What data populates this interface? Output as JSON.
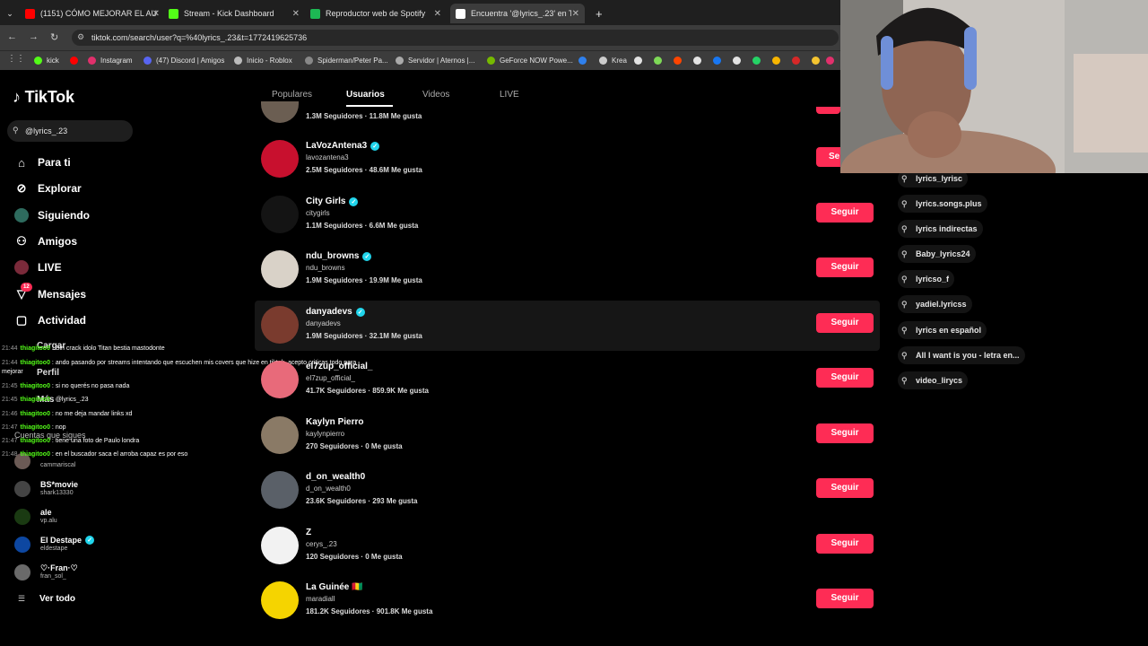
{
  "browser": {
    "tabs": [
      {
        "title": "(1151) CÓMO MEJORAR EL AU",
        "color": "#ff0000"
      },
      {
        "title": "Stream - Kick Dashboard",
        "color": "#53fc18"
      },
      {
        "title": "Reproductor web de Spotify: m",
        "color": "#1db954"
      },
      {
        "title": "Encuentra '@lyrics_.23' en TikTo",
        "color": "#ffffff"
      }
    ],
    "new_tab": "+",
    "url": "tiktok.com/search/user?q=%40lyrics_.23&t=1772419625736",
    "bookmarks": [
      {
        "label": "kick",
        "color": "#53fc18"
      },
      {
        "label": "",
        "color": "#ff0000"
      },
      {
        "label": "Instagram",
        "color": "#e1306c"
      },
      {
        "label": "(47) Discord | Amigos",
        "color": "#5865f2"
      },
      {
        "label": "Inicio - Roblox",
        "color": "#bbbbbb"
      },
      {
        "label": "Spiderman/Peter Pa...",
        "color": "#888888"
      },
      {
        "label": "Servidor | Aternos |...",
        "color": "#aaaaaa"
      },
      {
        "label": "GeForce NOW Powe...",
        "color": "#76b900"
      },
      {
        "label": "",
        "color": "#2f80ed"
      },
      {
        "label": "Krea",
        "color": "#cccccc"
      }
    ]
  },
  "tiktok": {
    "logo": "TikTok",
    "search_value": "@lyrics_.23",
    "nav": [
      {
        "label": "Para ti",
        "icon": "home-icon"
      },
      {
        "label": "Explorar",
        "icon": "compass-icon"
      },
      {
        "label": "Siguiendo",
        "icon": "following-icon"
      },
      {
        "label": "Amigos",
        "icon": "friends-icon"
      },
      {
        "label": "LIVE",
        "icon": "live-icon"
      },
      {
        "label": "Mensajes",
        "icon": "messages-icon",
        "badge": "12"
      },
      {
        "label": "Actividad",
        "icon": "activity-icon"
      }
    ],
    "tabs": [
      "Populares",
      "Usuarios",
      "Videos",
      "LIVE"
    ],
    "active_tab": "Usuarios",
    "partial_top_row": {
      "stats": "1.3M Seguidores · 11.8M Me gusta"
    },
    "users": [
      {
        "name": "LaVozAntena3",
        "handle": "lavozantena3",
        "stats": "2.5M Seguidores · 48.6M Me gusta",
        "verified": true,
        "button": "Se",
        "color": "#c8102e"
      },
      {
        "name": "City Girls",
        "handle": "citygirls",
        "stats": "1.1M Seguidores · 6.6M Me gusta",
        "verified": true,
        "button": "Seguir",
        "color": "#141414"
      },
      {
        "name": "ndu_browns",
        "handle": "ndu_browns",
        "stats": "1.9M Seguidores · 19.9M Me gusta",
        "verified": true,
        "button": "Seguir",
        "color": "#d9d2c8"
      },
      {
        "name": "danyadevs",
        "handle": "danyadevs",
        "stats": "1.9M Seguidores · 32.1M Me gusta",
        "verified": true,
        "button": "Seguir",
        "color": "#7a3b2e"
      },
      {
        "name": "el7zup_official_",
        "handle": "el7zup_official_",
        "stats": "41.7K Seguidores · 859.9K Me gusta",
        "verified": false,
        "button": "Seguir",
        "color": "#e86a7a"
      },
      {
        "name": "Kaylyn Pierro",
        "handle": "kaylynpierro",
        "stats": "270 Seguidores · 0 Me gusta",
        "verified": false,
        "button": "Seguir",
        "color": "#8a7a66"
      },
      {
        "name": "d_on_wealth0",
        "handle": "d_on_wealth0",
        "stats": "23.6K Seguidores · 293 Me gusta",
        "verified": false,
        "button": "Seguir",
        "color": "#5a6068"
      },
      {
        "name": "Z",
        "handle": "cerys_.23",
        "stats": "120 Seguidores · 0 Me gusta",
        "verified": false,
        "button": "Seguir",
        "color": "#f2f2f2"
      },
      {
        "name": "La Guinée 🇬🇳",
        "handle": "maradiall",
        "stats": "181.2K Seguidores · 901.8K Me gusta",
        "verified": false,
        "button": "Seguir",
        "color": "#f5d400"
      }
    ],
    "suggestions": [
      "lyrics_lyrisc",
      "lyrics.songs.plus",
      "lyrics indirectas",
      "Baby_lyrics24",
      "lyricso_f",
      "yadiel.lyricss",
      "lyrics en español",
      "All I want is you - letra en...",
      "video_lirycs"
    ],
    "hidden_nav": [
      "Cargar",
      "Perfil",
      "Más"
    ],
    "following_title": "Cuentas que sigues",
    "following": [
      {
        "name": "",
        "handle": "cammariscal",
        "color": "#6b5a55"
      },
      {
        "name": "BS*movie",
        "handle": "shark13330",
        "color": "#444444"
      },
      {
        "name": "ale",
        "handle": "vp.alu",
        "color": "#1a3a12"
      },
      {
        "name": "El Destape",
        "handle": "eldestape",
        "color": "#0d47a1",
        "verified": true
      },
      {
        "name": "♡·Fran·♡",
        "handle": "fran_sol_",
        "color": "#6a6a6a"
      }
    ],
    "ver_todo": "Ver todo"
  },
  "chat": [
    {
      "time": "21:44",
      "user": "thiagitoo0",
      "msg": "Siri crack idolo Titan bestia mastodonte"
    },
    {
      "time": "21:44",
      "user": "thiagitoo0",
      "msg": "ando pasando por streams intentando que escuchen mis covers que hize en tiktok, acepto criticas todo para mejorar"
    },
    {
      "time": "21:45",
      "user": "thiagitoo0",
      "msg": "si no querés no pasa nada"
    },
    {
      "time": "21:45",
      "user": "thiagitoo0",
      "msg": "@lyrics_.23"
    },
    {
      "time": "21:46",
      "user": "thiagitoo0",
      "msg": "no me deja mandar links xd"
    },
    {
      "time": "21:47",
      "user": "thiagitoo0",
      "msg": "nop"
    },
    {
      "time": "21:47",
      "user": "thiagitoo0",
      "msg": "tiene una foto de Paulo londra"
    },
    {
      "time": "21:48",
      "user": "thiagitoo0",
      "msg": "en el buscador saca el arroba capaz es por eso"
    }
  ],
  "colors": {
    "accent": "#fe2c55",
    "verified": "#20d5ec",
    "kick": "#53fc18"
  }
}
